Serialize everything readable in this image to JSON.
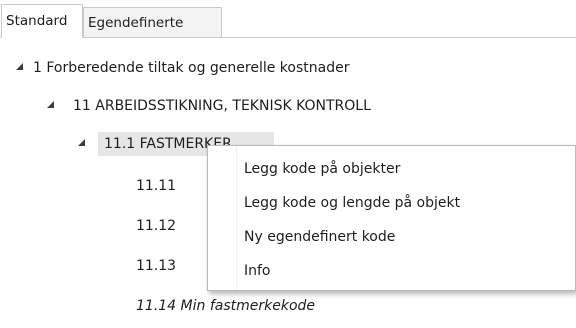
{
  "tabs": [
    {
      "label": "Standard"
    },
    {
      "label": "Egendefinerte"
    }
  ],
  "tree": {
    "node1": "1 Forberedende tiltak og generelle kostnader",
    "node11": "11 ARBEIDSSTIKNING, TEKNISK KONTROLL",
    "node111": "11.1 FASTMERKER",
    "node1111": "11.11",
    "node1112": "11.12",
    "node1113": "11.13",
    "node1114": "11.14 Min fastmerkekode"
  },
  "context_menu": {
    "items": [
      "Legg kode på objekter",
      "Legg kode og lengde på objekt",
      "Ny egendefinert kode",
      "Info"
    ]
  },
  "icons": {
    "expanded": "expanded-triangle-icon"
  }
}
